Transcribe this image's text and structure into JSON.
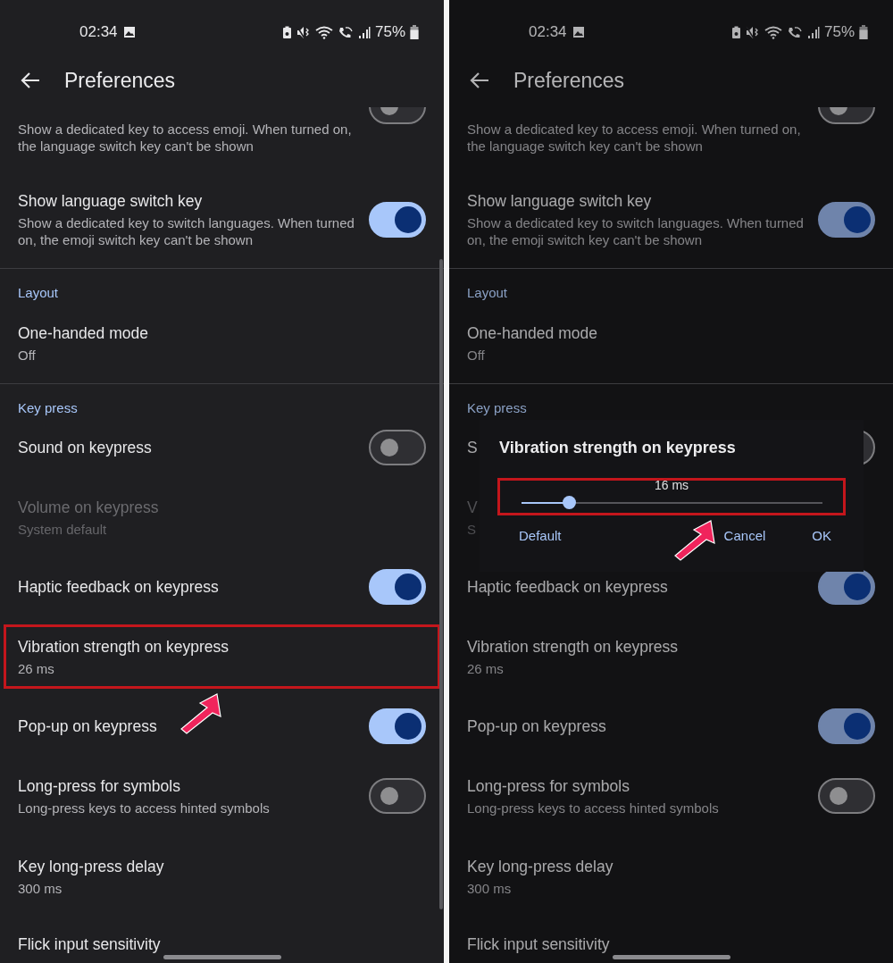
{
  "screens": [
    {
      "dimmed": false,
      "status_bar": {
        "time": "02:34",
        "battery": "75%"
      },
      "title": "Preferences",
      "items": [
        {
          "kind": "switch",
          "description": "Show a dedicated key to access emoji. When turned on, the language switch key can't be shown",
          "on": false,
          "disabled": false,
          "highlighted": false
        },
        {
          "kind": "switch",
          "title": "Show language switch key",
          "description": "Show a dedicated key to switch languages. When turned on, the emoji switch key can't be shown",
          "on": true,
          "disabled": false,
          "highlighted": false
        },
        {
          "kind": "divider"
        },
        {
          "kind": "header",
          "title": "Layout"
        },
        {
          "kind": "setting",
          "title": "One-handed mode",
          "description": "Off",
          "disabled": false,
          "highlighted": false
        },
        {
          "kind": "divider"
        },
        {
          "kind": "header",
          "title": "Key press"
        },
        {
          "kind": "switch",
          "title": "Sound on keypress",
          "on": false,
          "disabled": false,
          "highlighted": false
        },
        {
          "kind": "setting",
          "title": "Volume on keypress",
          "description": "System default",
          "disabled": true,
          "highlighted": false
        },
        {
          "kind": "switch",
          "title": "Haptic feedback on keypress",
          "on": true,
          "disabled": false,
          "highlighted": false
        },
        {
          "kind": "setting",
          "title": "Vibration strength on keypress",
          "description": "26 ms",
          "disabled": false,
          "highlighted": true
        },
        {
          "kind": "switch",
          "title": "Pop-up on keypress",
          "on": true,
          "disabled": false,
          "highlighted": false
        },
        {
          "kind": "switch",
          "title": "Long-press for symbols",
          "description": "Long-press keys to access hinted symbols",
          "on": false,
          "disabled": false,
          "highlighted": false
        },
        {
          "kind": "setting",
          "title": "Key long-press delay",
          "description": "300 ms",
          "disabled": false,
          "highlighted": false
        },
        {
          "kind": "setting",
          "title": "Flick input sensitivity",
          "disabled": false,
          "highlighted": false
        }
      ]
    },
    {
      "dimmed": true,
      "status_bar": {
        "time": "02:34",
        "battery": "75%"
      },
      "title": "Preferences",
      "items": [
        {
          "kind": "switch",
          "description": "Show a dedicated key to access emoji. When turned on, the language switch key can't be shown",
          "on": false,
          "disabled": false,
          "highlighted": false
        },
        {
          "kind": "switch",
          "title": "Show language switch key",
          "description": "Show a dedicated key to switch languages. When turned on, the emoji switch key can't be shown",
          "on": true,
          "disabled": false,
          "highlighted": false
        },
        {
          "kind": "divider"
        },
        {
          "kind": "header",
          "title": "Layout"
        },
        {
          "kind": "setting",
          "title": "One-handed mode",
          "description": "Off",
          "disabled": false,
          "highlighted": false
        },
        {
          "kind": "divider"
        },
        {
          "kind": "header",
          "title": "Key press"
        },
        {
          "kind": "switch",
          "title": "S",
          "on": false,
          "disabled": false,
          "highlighted": false
        },
        {
          "kind": "setting",
          "title": "V",
          "description": "S",
          "disabled": true,
          "highlighted": false
        },
        {
          "kind": "switch",
          "title": "Haptic feedback on keypress",
          "on": true,
          "disabled": false,
          "highlighted": false
        },
        {
          "kind": "setting",
          "title": "Vibration strength on keypress",
          "description": "26 ms",
          "disabled": false,
          "highlighted": false
        },
        {
          "kind": "switch",
          "title": "Pop-up on keypress",
          "on": true,
          "disabled": false,
          "highlighted": false
        },
        {
          "kind": "switch",
          "title": "Long-press for symbols",
          "description": "Long-press keys to access hinted symbols",
          "on": false,
          "disabled": false,
          "highlighted": false
        },
        {
          "kind": "setting",
          "title": "Key long-press delay",
          "description": "300 ms",
          "disabled": false,
          "highlighted": false
        },
        {
          "kind": "setting",
          "title": "Flick input sensitivity",
          "disabled": false,
          "highlighted": false
        }
      ],
      "dialog": {
        "title": "Vibration strength on keypress",
        "reading": "16 ms",
        "level": 0.16,
        "highlighted": true,
        "buttons": [
          "Default",
          "Cancel",
          "OK"
        ]
      }
    }
  ]
}
